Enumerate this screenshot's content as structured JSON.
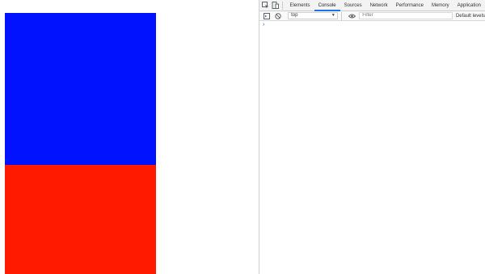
{
  "page": {
    "blue_box_color": "#0012ff",
    "red_box_color": "#ff1a00"
  },
  "devtools": {
    "tabs": [
      {
        "label": "Elements"
      },
      {
        "label": "Console",
        "active": true
      },
      {
        "label": "Sources"
      },
      {
        "label": "Network"
      },
      {
        "label": "Performance"
      },
      {
        "label": "Memory"
      },
      {
        "label": "Application"
      }
    ],
    "icons": [
      "inspect-element-icon",
      "device-toolbar-icon",
      "console-sidebar-icon",
      "clear-console-icon",
      "eye-icon"
    ],
    "console": {
      "context_value": "top",
      "filter_placeholder": "Filter",
      "levels_label": "Default levels",
      "prompt_symbol": "›"
    },
    "accent_color": "#1a73e8"
  }
}
